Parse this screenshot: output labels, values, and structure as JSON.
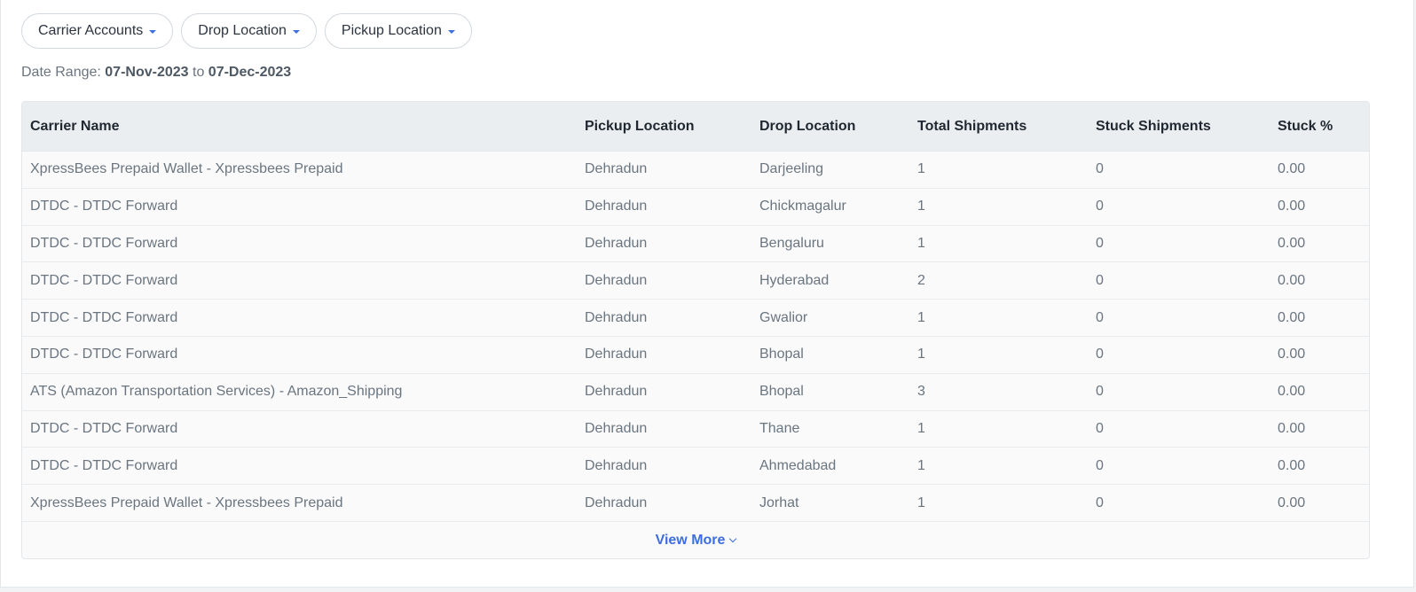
{
  "filters": {
    "carrier_accounts": "Carrier Accounts",
    "drop_location": "Drop Location",
    "pickup_location": "Pickup Location"
  },
  "date_range": {
    "label": "Date Range: ",
    "from": "07-Nov-2023",
    "separator": " to ",
    "to": "07-Dec-2023"
  },
  "table": {
    "headers": {
      "carrier": "Carrier Name",
      "pickup": "Pickup Location",
      "drop": "Drop Location",
      "total": "Total Shipments",
      "stuck": "Stuck Shipments",
      "pct": "Stuck %"
    },
    "rows": [
      {
        "carrier": "XpressBees Prepaid Wallet - Xpressbees Prepaid",
        "pickup": "Dehradun",
        "drop": "Darjeeling",
        "total": "1",
        "stuck": "0",
        "pct": "0.00"
      },
      {
        "carrier": "DTDC - DTDC Forward",
        "pickup": "Dehradun",
        "drop": "Chickmagalur",
        "total": "1",
        "stuck": "0",
        "pct": "0.00"
      },
      {
        "carrier": "DTDC - DTDC Forward",
        "pickup": "Dehradun",
        "drop": "Bengaluru",
        "total": "1",
        "stuck": "0",
        "pct": "0.00"
      },
      {
        "carrier": "DTDC - DTDC Forward",
        "pickup": "Dehradun",
        "drop": "Hyderabad",
        "total": "2",
        "stuck": "0",
        "pct": "0.00"
      },
      {
        "carrier": "DTDC - DTDC Forward",
        "pickup": "Dehradun",
        "drop": "Gwalior",
        "total": "1",
        "stuck": "0",
        "pct": "0.00"
      },
      {
        "carrier": "DTDC - DTDC Forward",
        "pickup": "Dehradun",
        "drop": "Bhopal",
        "total": "1",
        "stuck": "0",
        "pct": "0.00"
      },
      {
        "carrier": "ATS (Amazon Transportation Services) - Amazon_Shipping",
        "pickup": "Dehradun",
        "drop": "Bhopal",
        "total": "3",
        "stuck": "0",
        "pct": "0.00"
      },
      {
        "carrier": "DTDC - DTDC Forward",
        "pickup": "Dehradun",
        "drop": "Thane",
        "total": "1",
        "stuck": "0",
        "pct": "0.00"
      },
      {
        "carrier": "DTDC - DTDC Forward",
        "pickup": "Dehradun",
        "drop": "Ahmedabad",
        "total": "1",
        "stuck": "0",
        "pct": "0.00"
      },
      {
        "carrier": "XpressBees Prepaid Wallet - Xpressbees Prepaid",
        "pickup": "Dehradun",
        "drop": "Jorhat",
        "total": "1",
        "stuck": "0",
        "pct": "0.00"
      }
    ]
  },
  "view_more": "View More",
  "colors": {
    "accent": "#3b6fe0",
    "header_bg": "#ebeef1",
    "text_muted": "#6a7580"
  }
}
